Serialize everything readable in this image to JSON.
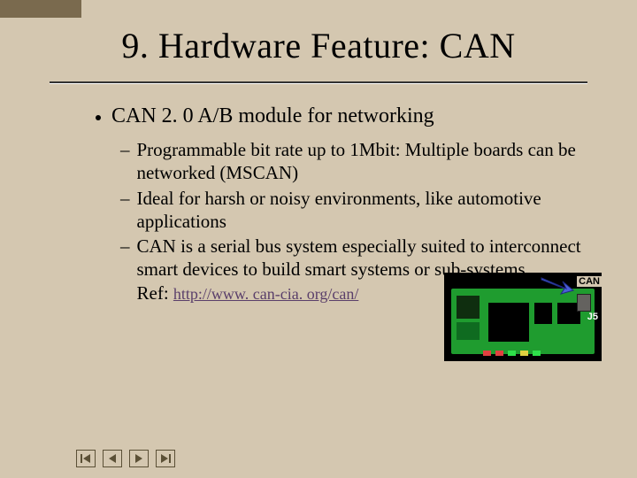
{
  "title": "9. Hardware Feature: CAN",
  "bullets": {
    "main": "CAN 2. 0 A/B module for networking",
    "subs": [
      "Programmable bit rate up to 1Mbit: Multiple boards can be networked (MSCAN)",
      "Ideal for harsh or noisy environments, like automotive applications",
      "CAN is a serial bus system especially suited to interconnect smart devices to build smart systems or sub-systems."
    ],
    "ref_prefix": "Ref:",
    "ref_url": "http://www. can-cia. org/can/"
  },
  "board": {
    "label_can": "CAN",
    "label_j5": "J5"
  },
  "nav": {
    "first": "first-slide",
    "prev": "previous-slide",
    "next": "next-slide",
    "last": "last-slide"
  },
  "colors": {
    "bg": "#d4c7b0",
    "pcb": "#1f9c2f",
    "arrow": "#4a5fd8"
  }
}
